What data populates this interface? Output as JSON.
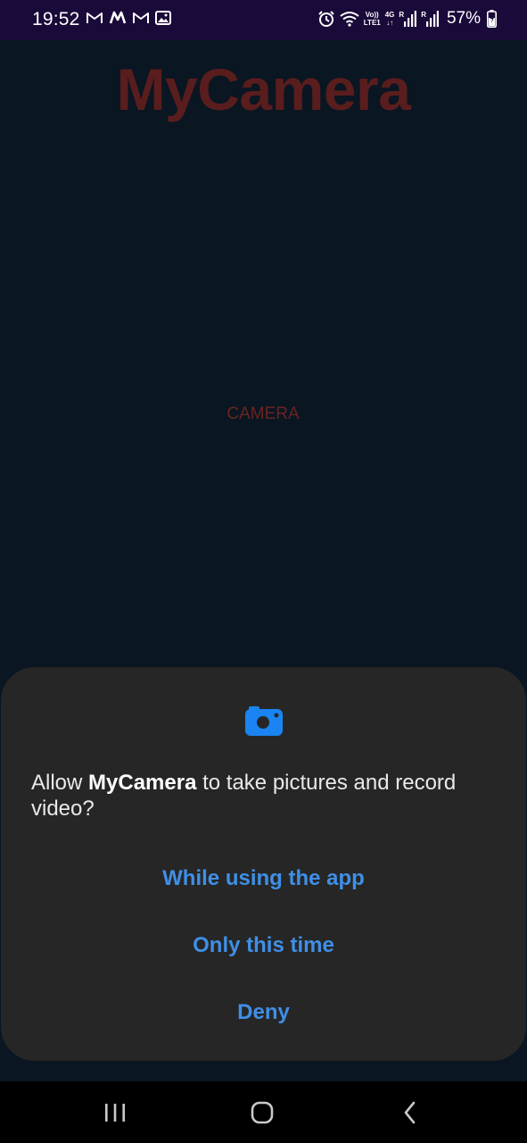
{
  "status_bar": {
    "time": "19:52",
    "left_icons": [
      "gmail-icon",
      "m-app-icon",
      "gmail-icon",
      "gallery-icon"
    ],
    "right_icons": [
      "alarm-icon",
      "wifi-icon",
      "volte-icon",
      "4g-icon",
      "signal-icon",
      "signal-icon",
      "battery-icon"
    ],
    "volte_top": "Vo))",
    "volte_bottom": "LTE1",
    "net_type": "4G",
    "roaming": "R",
    "battery": "57%"
  },
  "app": {
    "title": "MyCamera",
    "camera_button": "CAMERA"
  },
  "permission_dialog": {
    "icon": "camera-icon",
    "message_prefix": "Allow ",
    "app_name": "MyCamera",
    "message_suffix": " to take pictures and record video?",
    "options": [
      "While using the app",
      "Only this time",
      "Deny"
    ]
  },
  "nav_bar": {
    "buttons": [
      "recents-icon",
      "home-icon",
      "back-icon"
    ]
  },
  "colors": {
    "status_bar_bg": "#1a0a3a",
    "app_bg": "#0a1621",
    "title": "#5a1d1d",
    "sheet_bg": "#262626",
    "accent": "#3f8fe6",
    "icon_blue": "#1a84f2"
  }
}
